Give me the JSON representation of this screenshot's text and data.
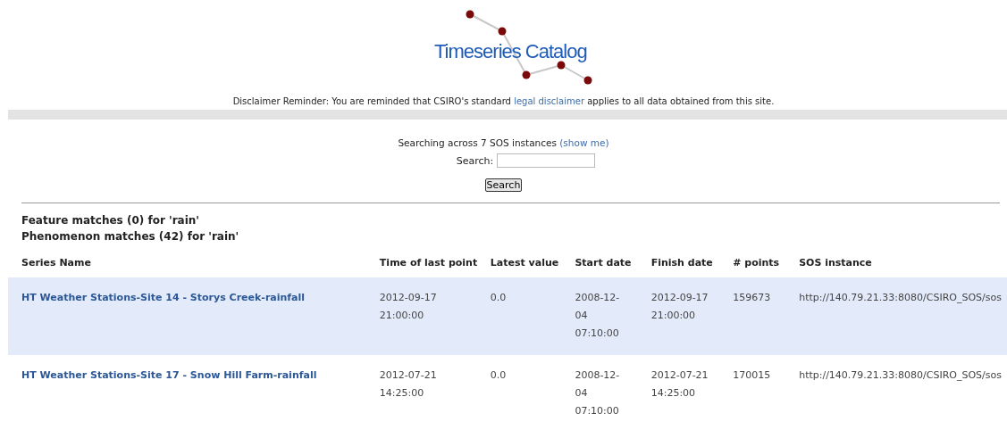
{
  "logo": {
    "title": "Timeseries Catalog"
  },
  "disclaimer": {
    "before": "Disclaimer Reminder: You are reminded that CSIRO's standard ",
    "link": "legal disclaimer",
    "after": " applies to all data obtained from this site."
  },
  "search": {
    "summary": "Searching across 7 SOS instances",
    "summary_link": "(show me)",
    "label": "Search:",
    "button": "Search"
  },
  "results": {
    "feature_heading": "Feature matches (0) for 'rain'",
    "phenomenon_heading": "Phenomenon matches (42) for 'rain'"
  },
  "table": {
    "columns": [
      "Series Name",
      "Time of last point",
      "Latest value",
      "Start date",
      "Finish date",
      "# points",
      "SOS instance"
    ],
    "rows": [
      {
        "shaded": true,
        "cells": [
          "HT Weather Stations-Site 14 - Storys Creek-rainfall",
          "2012-09-17 21:00:00",
          "0.0",
          "2008-12-04 07:10:00",
          "2012-09-17 21:00:00",
          "159673",
          "http://140.79.21.33:8080/CSIRO_SOS/sos"
        ]
      },
      {
        "shaded": false,
        "cells": [
          "HT Weather Stations-Site 17 - Snow Hill Farm-rainfall",
          "2012-07-21 14:25:00",
          "0.0",
          "2008-12-04 07:10:00",
          "2012-07-21 14:25:00",
          "170015",
          "http://140.79.21.33:8080/CSIRO_SOS/sos"
        ]
      }
    ]
  }
}
